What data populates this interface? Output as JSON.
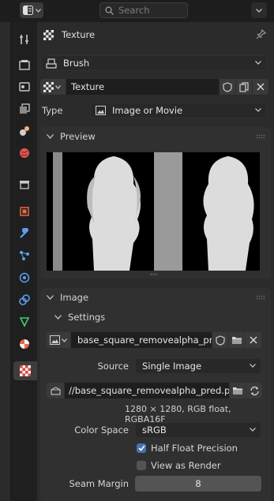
{
  "search": {
    "placeholder": "Search"
  },
  "header": {
    "title": "Texture"
  },
  "brush_select": {
    "value": "Brush"
  },
  "texture_block": {
    "name": "Texture"
  },
  "type_row": {
    "label": "Type",
    "value": "Image or Movie"
  },
  "preview_panel": {
    "title": "Preview"
  },
  "image_panel": {
    "title": "Image",
    "settings_title": "Settings",
    "image_name": "base_square_removealpha_pr...",
    "source_label": "Source",
    "source_value": "Single Image",
    "filepath": "//base_square_removealpha_pred.png",
    "info": "1280 × 1280, RGB float, RGBA16F",
    "colorspace_label": "Color Space",
    "colorspace_value": "sRGB",
    "half_float_label": "Half Float Precision",
    "half_float_checked": true,
    "view_as_render_label": "View as Render",
    "view_as_render_checked": false,
    "seam_margin_label": "Seam Margin",
    "seam_margin_value": "8"
  },
  "tabs": [
    "tool-icon",
    "render-icon",
    "output-icon",
    "view-layer-icon",
    "scene-icon",
    "world-icon",
    "collection-icon",
    "object-icon",
    "modifier-icon",
    "particles-icon",
    "physics-icon",
    "constraints-icon",
    "data-icon",
    "material-icon",
    "texture-icon"
  ],
  "colors": {
    "accent": "#4772b3",
    "background": "#2b2b2b",
    "panel": "#303030"
  }
}
